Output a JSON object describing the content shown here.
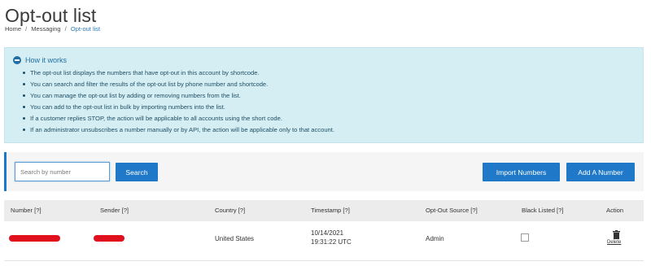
{
  "page": {
    "title": "Opt-out list",
    "breadcrumb": [
      "Home",
      "Messaging",
      "Opt-out list"
    ],
    "breadcrumb_separator": "/"
  },
  "info": {
    "heading": "How it works",
    "items": [
      "The opt-out list displays the numbers that have opt-out in this account by shortcode.",
      "You can search and filter the results of the opt-out list by phone number and shortcode.",
      "You can manage the opt-out list by adding or removing numbers from the list.",
      "You can add to the opt-out list in bulk by importing numbers into the list.",
      "If a customer replies STOP, the action will be applicable to all accounts using the short code.",
      "If an administrator unsubscribes a number manually or by API, the action will be applicable only to that account."
    ]
  },
  "toolbar": {
    "search_placeholder": "Search by number",
    "search_label": "Search",
    "import_label": "Import Numbers",
    "add_label": "Add A Number"
  },
  "table": {
    "headers": [
      "Number [?]",
      "Sender [?]",
      "Country [?]",
      "Timestamp [?]",
      "Opt-Out Source [?]",
      "Black Listed [?]",
      "Action"
    ],
    "rows": [
      {
        "number": "",
        "sender": "",
        "country": "United States",
        "timestamp_date": "10/14/2021",
        "timestamp_time": "19:31:22 UTC",
        "source": "Admin",
        "black_listed": false,
        "action": "Delete"
      }
    ]
  },
  "colors": {
    "accent": "#1f78c8",
    "info_bg": "#d5eef3",
    "redaction": "#e0101c"
  },
  "icons": [
    "minus-circle-icon",
    "trash-icon"
  ]
}
